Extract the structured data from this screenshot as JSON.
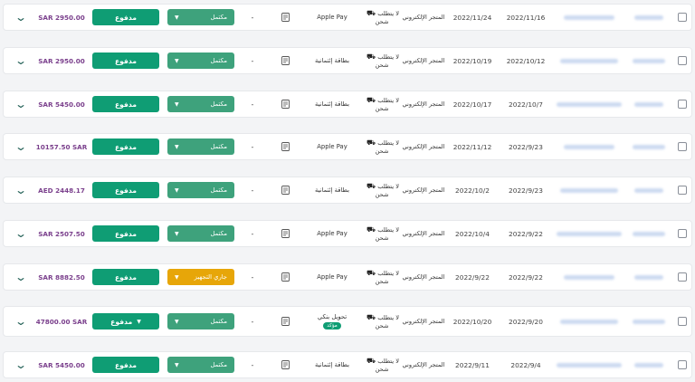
{
  "common": {
    "paid_label": "مدفوع",
    "dash": "-",
    "ship_text": "لا يتطلب شحن",
    "source_text": "المتجر الإلكتروني",
    "icons": {
      "expand": "chevron-down-icon",
      "pay_caret": "caret-down-icon",
      "document": "document-icon",
      "truck": "truck-icon",
      "checkbox": "checkbox-icon"
    }
  },
  "colors": {
    "paid": "#0f9d74",
    "complete": "#3ea27c",
    "pending": "#e7a609",
    "amount": "#7a3f8c"
  },
  "orders": [
    {
      "amount": "SAR 2950.00",
      "status": "مكتمل",
      "status_type": "complete",
      "method": "Apple Pay",
      "date_a": "2022/11/24",
      "date_b": "2022/11/16"
    },
    {
      "amount": "SAR 2950.00",
      "status": "مكتمل",
      "status_type": "complete",
      "method": "بطاقة إئتمانية",
      "date_a": "2022/10/19",
      "date_b": "2022/10/12"
    },
    {
      "amount": "SAR 5450.00",
      "status": "مكتمل",
      "status_type": "complete",
      "method": "بطاقة إئتمانية",
      "date_a": "2022/10/17",
      "date_b": "2022/10/7"
    },
    {
      "amount": "10157.50 SAR",
      "status": "مكتمل",
      "status_type": "complete",
      "method": "Apple Pay",
      "date_a": "2022/11/12",
      "date_b": "2022/9/23"
    },
    {
      "amount": "AED 2448.17",
      "status": "مكتمل",
      "status_type": "complete",
      "method": "بطاقة إئتمانية",
      "date_a": "2022/10/2",
      "date_b": "2022/9/23"
    },
    {
      "amount": "SAR 2507.50",
      "status": "مكتمل",
      "status_type": "complete",
      "method": "Apple Pay",
      "date_a": "2022/10/4",
      "date_b": "2022/9/22"
    },
    {
      "amount": "SAR 8882.50",
      "status": "جاري التجهيز",
      "status_type": "pending",
      "method": "Apple Pay",
      "date_a": "2022/9/22",
      "date_b": "2022/9/22"
    },
    {
      "amount": "47800.00 SAR",
      "status": "مكتمل",
      "status_type": "complete",
      "method": "تحويل بنكي",
      "badge": "مؤكد",
      "date_a": "2022/10/20",
      "date_b": "2022/9/20"
    },
    {
      "amount": "SAR 5450.00",
      "status": "مكتمل",
      "status_type": "complete",
      "method": "بطاقة إئتمانية",
      "date_a": "2022/9/11",
      "date_b": "2022/9/4"
    }
  ]
}
